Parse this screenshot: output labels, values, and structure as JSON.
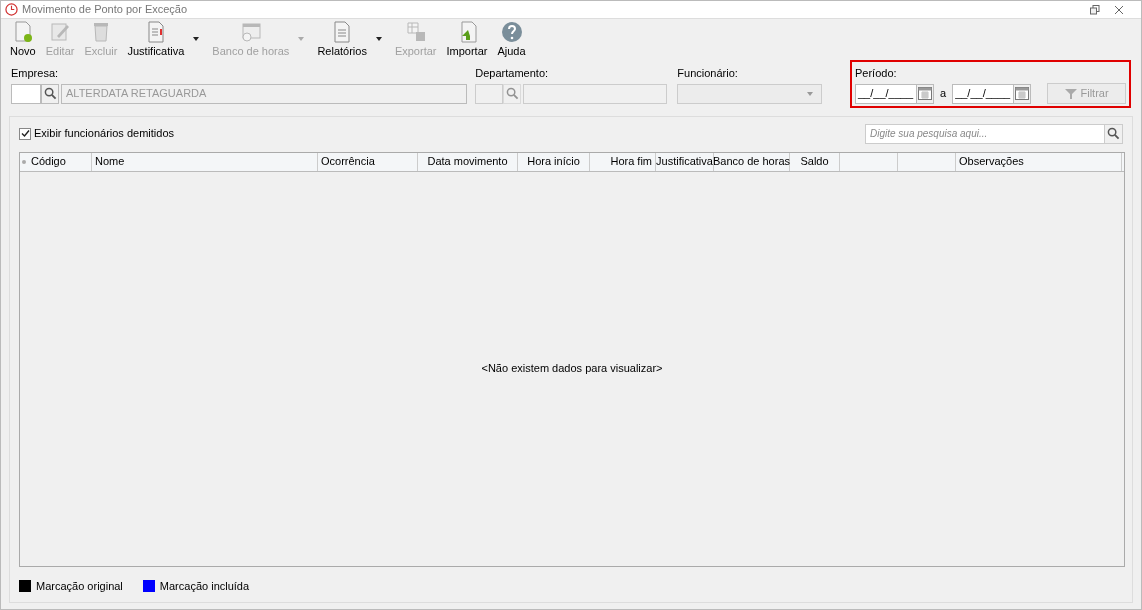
{
  "window": {
    "title": "Movimento de Ponto por Exceção"
  },
  "toolbar": [
    {
      "label": "Novo",
      "kind": "new",
      "disabled": false,
      "dropdown": false
    },
    {
      "label": "Editar",
      "kind": "edit",
      "disabled": true,
      "dropdown": false
    },
    {
      "label": "Excluir",
      "kind": "delete",
      "disabled": true,
      "dropdown": false
    },
    {
      "label": "Justificativa",
      "kind": "justify",
      "disabled": false,
      "dropdown": true
    },
    {
      "label": "Banco de horas",
      "kind": "calendar",
      "disabled": true,
      "dropdown": true
    },
    {
      "label": "Relatórios",
      "kind": "report",
      "disabled": false,
      "dropdown": true
    },
    {
      "label": "Exportar",
      "kind": "export",
      "disabled": true,
      "dropdown": false
    },
    {
      "label": "Importar",
      "kind": "import",
      "disabled": false,
      "dropdown": false
    },
    {
      "label": "Ajuda",
      "kind": "help",
      "disabled": false,
      "dropdown": false
    }
  ],
  "filters": {
    "empresa": {
      "label": "Empresa:",
      "name": "ALTERDATA RETAGUARDA"
    },
    "departamento": {
      "label": "Departamento:"
    },
    "funcionario": {
      "label": "Funcionário:"
    },
    "periodo": {
      "label": "Período:",
      "from": "__/__/____",
      "separator": "a",
      "to": "__/__/____",
      "button": "Filtrar"
    }
  },
  "show_dismissed": {
    "label": "Exibir funcionários demitidos",
    "checked": true
  },
  "search": {
    "placeholder": "Digite sua pesquisa aqui..."
  },
  "table": {
    "columns": [
      "Código",
      "Nome",
      "Ocorrência",
      "Data movimento",
      "Hora início",
      "Hora fim",
      "Justificativa",
      "Banco de horas",
      "Saldo",
      "",
      "",
      "Observações"
    ],
    "empty": "<Não existem dados para visualizar>"
  },
  "legend": [
    {
      "label": "Marcação original",
      "color": "#000000"
    },
    {
      "label": "Marcação incluída",
      "color": "#0000ff"
    }
  ]
}
